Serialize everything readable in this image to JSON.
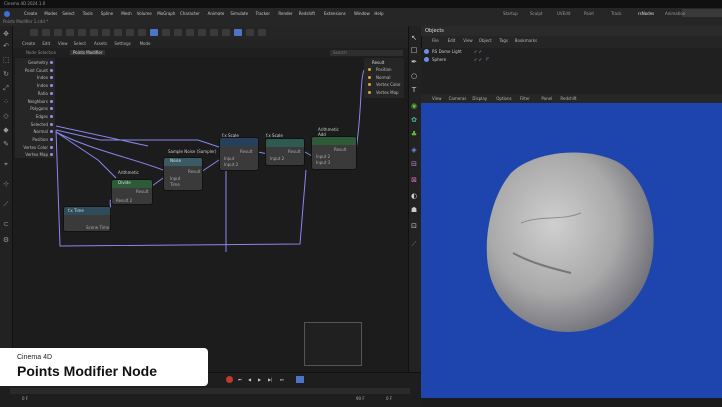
{
  "titlebar": {
    "text": "Cinema 4D 2024.1.0"
  },
  "menubar": {
    "items": [
      "Create",
      "Modes",
      "Select",
      "Tools",
      "Spline",
      "Mesh",
      "Volume",
      "MoGraph",
      "Character",
      "Animate",
      "Simulate",
      "Tracker",
      "Render",
      "Redshift",
      "Extensions",
      "Window",
      "Help"
    ],
    "doc_tab": "Points Modifier 1.c4d *",
    "workspaces": [
      "Startup",
      "Sculpt",
      "UVEdit",
      "Paint",
      "Track",
      "rsNodes",
      "Animation"
    ],
    "active_workspace": "rsNodes"
  },
  "node_editor": {
    "menu": [
      "Create",
      "Edit",
      "View",
      "Select",
      "Assets",
      "Settings",
      "Mode"
    ],
    "breadcrumb": [
      "Node Selection",
      "Points Modifier"
    ],
    "search_placeholder": "Search",
    "colors": {
      "wire": "#8a86f0",
      "port": "#9b8cf0",
      "canvas": "#1c1c1c"
    },
    "inputs_title": "Context",
    "inputs": [
      "Geometry",
      "Point Count",
      "Index",
      "Index",
      "Ratio",
      "Neighbors",
      "Polygons",
      "Edges",
      "Selected",
      "Normal",
      "Position",
      "Vertex Color",
      "Vertex Map"
    ],
    "outputs_title": "Result",
    "outputs": [
      "Position",
      "Normal",
      "Vertex Color",
      "Vertex Map"
    ],
    "nodes": [
      {
        "name": "f-time",
        "title": "f.x  Time",
        "color": "#2d4d5b",
        "ports": [
          "Scene Time"
        ]
      },
      {
        "name": "f-divide",
        "title": "Arithmetic",
        "subtitle": "Divide",
        "color": "#2e5a3a",
        "ports": [
          "Result",
          "Result 2"
        ]
      },
      {
        "name": "f-noise",
        "title": "Sample Noise (Sampler)",
        "subtitle": "Noise",
        "color": "#3a5a66",
        "ports": [
          "Result",
          "Input",
          "Time"
        ]
      },
      {
        "name": "f-scale",
        "title": "f.x  Scale",
        "color": "#263f5a",
        "ports": [
          "Result",
          "Input",
          "Input 2"
        ]
      },
      {
        "name": "f-scale2",
        "title": "f.x  Scale",
        "color": "#2e5a52",
        "ports": [
          "Result",
          "Input 2"
        ]
      },
      {
        "name": "f-add",
        "title": "Arithmetic",
        "subtitle": "Add",
        "color": "#2e5a3a",
        "ports": [
          "Result",
          "Input 2",
          "Input 3"
        ]
      }
    ]
  },
  "objects": {
    "title": "Objects",
    "menu": [
      "File",
      "Edit",
      "View",
      "Object",
      "Tags",
      "Bookmarks"
    ],
    "rows": [
      {
        "label": "RS Dome Light",
        "icon": "light-icon"
      },
      {
        "label": "Sphere",
        "icon": "sphere-icon"
      }
    ]
  },
  "viewport": {
    "menu": [
      "View",
      "Cameras",
      "Display",
      "Options",
      "Filter",
      "Panel",
      "Redshift"
    ],
    "bg": "#1d45ad"
  },
  "timeline": {
    "start_frame": "0 F",
    "end_frame": "90 F",
    "current": "0 F"
  },
  "lower_third": {
    "subtitle": "Cinema 4D",
    "title": "Points Modifier Node"
  }
}
